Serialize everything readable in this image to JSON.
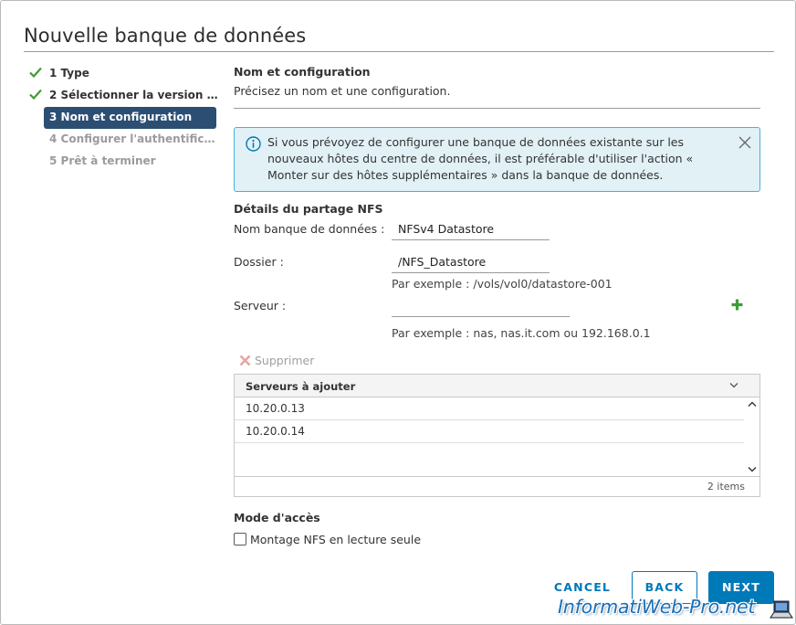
{
  "dialog": {
    "title": "Nouvelle banque de données"
  },
  "steps": [
    {
      "label": "1 Type",
      "state": "done"
    },
    {
      "label": "2 Sélectionner la version N...",
      "state": "done"
    },
    {
      "label": "3 Nom et configuration",
      "state": "active"
    },
    {
      "label": "4 Configurer l'authentificat...",
      "state": "disabled"
    },
    {
      "label": "5 Prêt à terminer",
      "state": "disabled"
    }
  ],
  "section": {
    "title": "Nom et configuration",
    "subtitle": "Précisez un nom et une configuration."
  },
  "alert": {
    "text": "Si vous prévoyez de configurer une banque de données existante sur les nouveaux hôtes du centre de données, il est préférable d'utiliser l'action « Monter sur des hôtes supplémentaires » dans la banque de données."
  },
  "nfs": {
    "heading": "Détails du partage NFS",
    "name_label": "Nom banque de données :",
    "name_value": "NFSv4 Datastore",
    "folder_label": "Dossier :",
    "folder_value": "/NFS_Datastore",
    "folder_hint": "Par exemple : /vols/vol0/datastore-001",
    "server_label": "Serveur :",
    "server_value": "",
    "server_hint": "Par exemple : nas, nas.it.com ou 192.168.0.1",
    "delete_label": "Supprimer"
  },
  "servers_grid": {
    "header": "Serveurs à ajouter",
    "rows": [
      "10.20.0.13",
      "10.20.0.14"
    ],
    "footer": "2 items"
  },
  "access": {
    "heading": "Mode d'accès",
    "readonly_label": "Montage NFS en lecture seule",
    "readonly_checked": false
  },
  "buttons": {
    "cancel": "CANCEL",
    "back": "BACK",
    "next": "NEXT"
  },
  "watermark": "InformatiWeb-Pro.net",
  "colors": {
    "primary": "#0079b8",
    "active_step": "#2c4e73",
    "check_green": "#3f9c35",
    "alert_bg": "#e1f1f6",
    "alert_border": "#49afd9"
  }
}
